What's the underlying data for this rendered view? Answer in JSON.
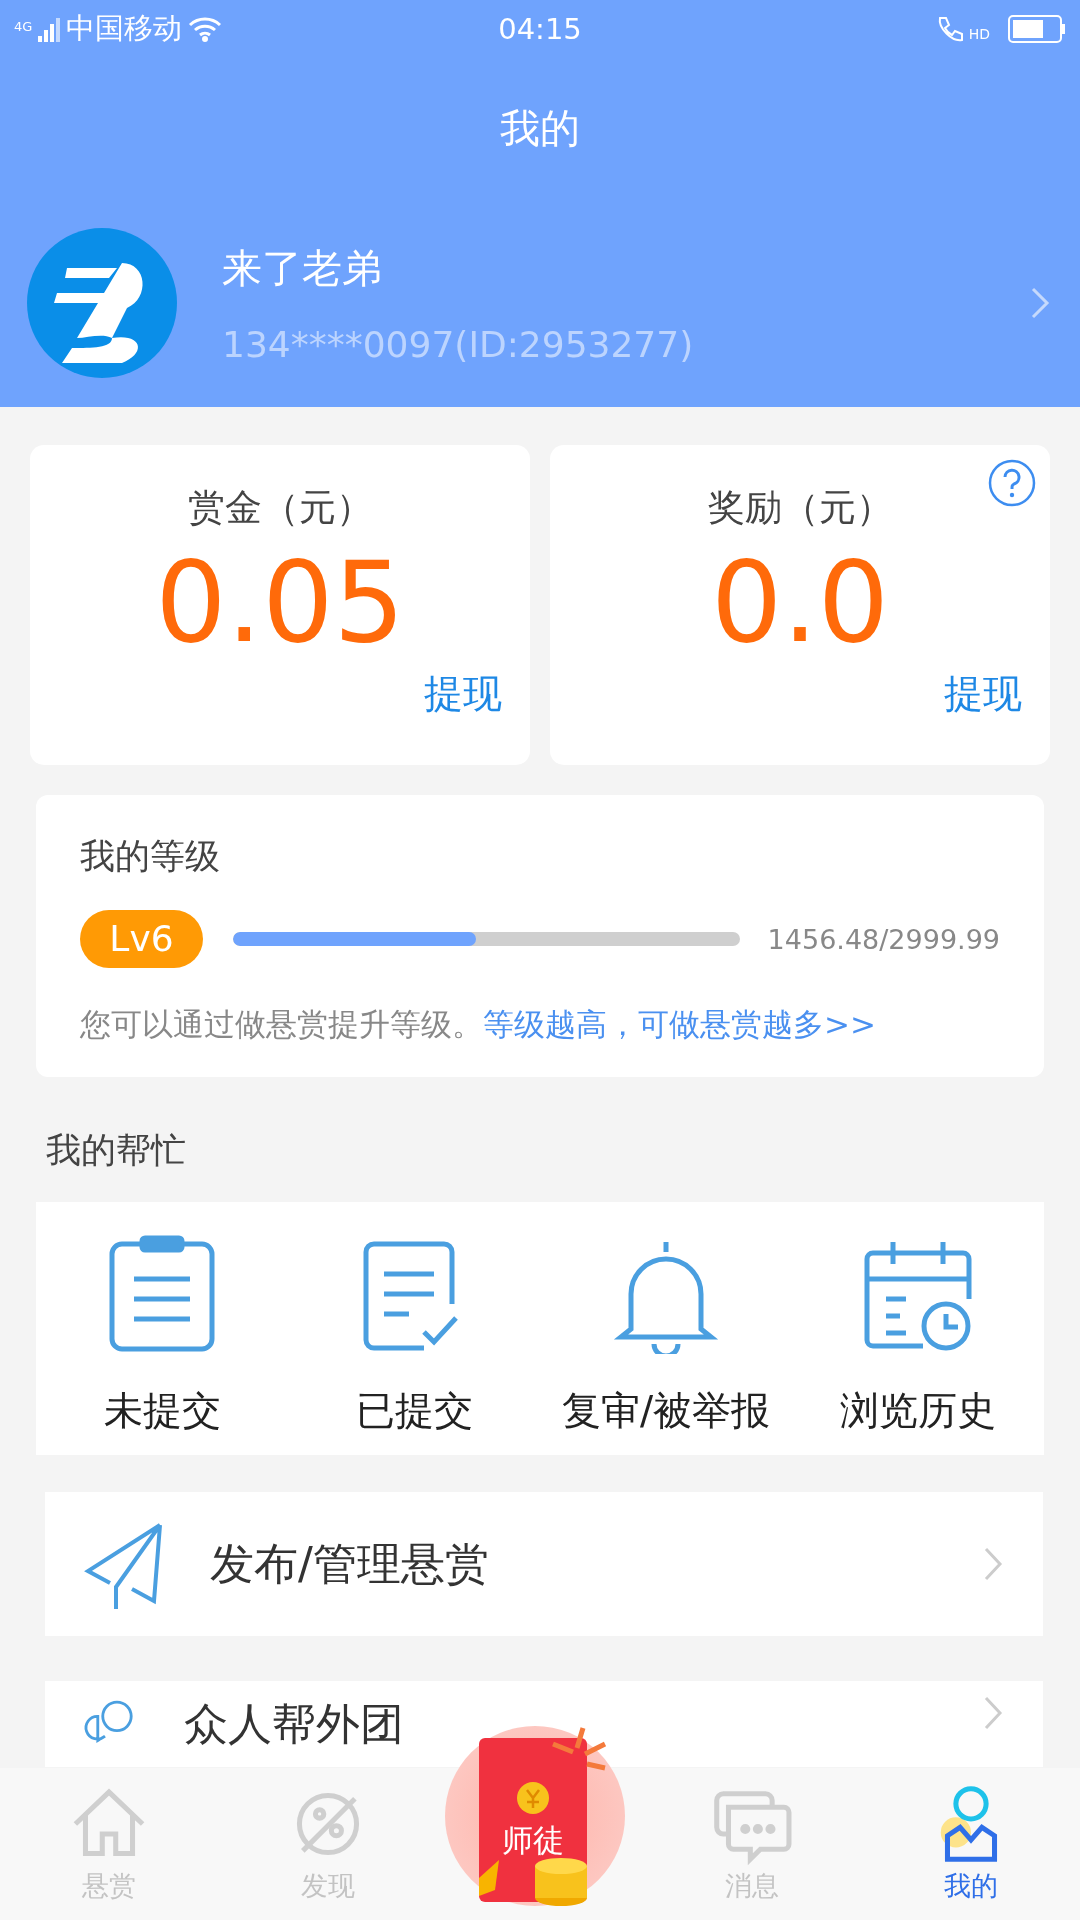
{
  "status_bar": {
    "network": "4G",
    "carrier": "中国移动",
    "time": "04:15",
    "call_badge": "HD"
  },
  "header": {
    "title": "我的"
  },
  "profile": {
    "name": "来了老弟",
    "account": "134****0097(ID:2953277)"
  },
  "balances": [
    {
      "label": "赏金（元）",
      "amount": "0.05",
      "action": "提现",
      "help": false
    },
    {
      "label": "奖励（元）",
      "amount": "0.0",
      "action": "提现",
      "help": true
    }
  ],
  "level": {
    "title": "我的等级",
    "badge": "Lv6",
    "level": 0.48,
    "reading": "1456.48/2999.99",
    "hint": "您可以通过做悬赏提升等级。",
    "link": "等级越高，可做悬赏越多>>"
  },
  "my_help": {
    "title": "我的帮忙",
    "items": [
      {
        "kind": "clipboard",
        "label": "未提交"
      },
      {
        "kind": "checklist",
        "label": "已提交"
      },
      {
        "kind": "bell",
        "label": "复审/被举报"
      },
      {
        "kind": "calendar",
        "label": "浏览历史"
      }
    ]
  },
  "menu": [
    {
      "kind": "plane",
      "label": "发布/管理悬赏"
    },
    {
      "kind": "chat",
      "label": "众人帮外团"
    }
  ],
  "tab_bar": [
    {
      "kind": "home",
      "label": "悬赏",
      "selected": false
    },
    {
      "kind": "discover",
      "label": "发现",
      "selected": false
    },
    {
      "kind": "envelope",
      "label": "师徒",
      "selected": false
    },
    {
      "kind": "message",
      "label": "消息",
      "selected": false
    },
    {
      "kind": "user",
      "label": "我的",
      "selected": true
    }
  ]
}
